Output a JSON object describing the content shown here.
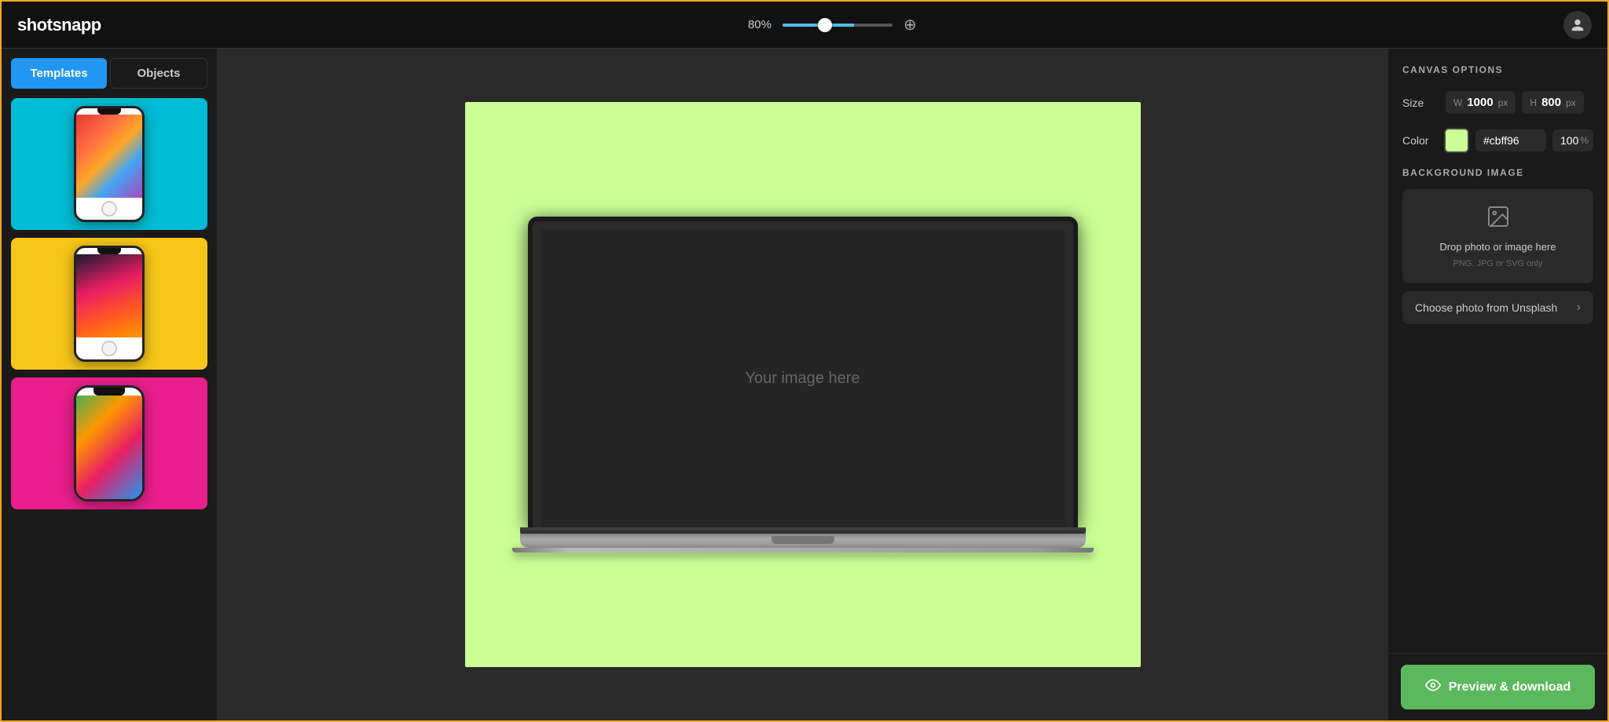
{
  "app": {
    "logo": "shotsnapp",
    "user_icon": "👤"
  },
  "topbar": {
    "zoom_value": "80%",
    "zoom_level": 80,
    "zoom_max": 200,
    "zoom_in_icon": "⊕"
  },
  "left_panel": {
    "tab_templates": "Templates",
    "tab_objects": "Objects",
    "templates": [
      {
        "id": "tpl-1",
        "bg": "cyan",
        "screen_type": "abstract"
      },
      {
        "id": "tpl-2",
        "bg": "yellow",
        "screen_type": "smoke"
      },
      {
        "id": "tpl-3",
        "bg": "pink",
        "screen_type": "character"
      }
    ]
  },
  "canvas": {
    "bg_color": "#cbff96",
    "placeholder_text": "Your image here"
  },
  "right_panel": {
    "options_title": "CANVAS OPTIONS",
    "size_label": "Size",
    "width_label": "W",
    "width_value": "1000",
    "height_label": "H",
    "height_value": "800",
    "px_unit": "px",
    "color_label": "Color",
    "color_hex": "#cbff96",
    "opacity_value": "100",
    "opacity_symbol": "%",
    "bg_image_title": "BACKGROUND IMAGE",
    "drop_main": "Drop photo or image here",
    "drop_sub": "PNG, JPG or SVG only",
    "unsplash_label": "Choose photo from Unsplash",
    "download_label": "Preview & download"
  }
}
